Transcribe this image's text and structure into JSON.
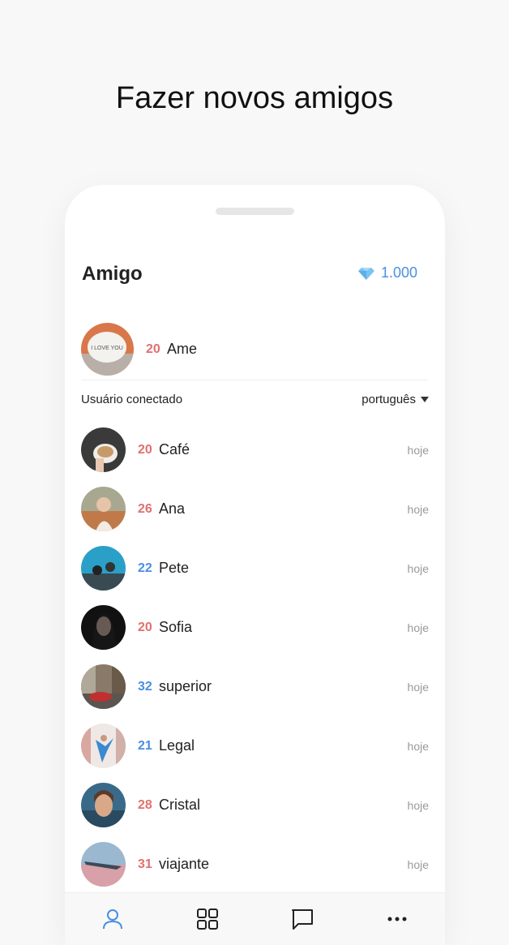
{
  "headline": "Fazer novos amigos",
  "header": {
    "title": "Amigo",
    "gems": "1.000",
    "gem_icon": "diamond-icon"
  },
  "me": {
    "age": "20",
    "name": "Ame",
    "gender": "f"
  },
  "section": {
    "label": "Usuário conectado",
    "language": "português"
  },
  "friends": [
    {
      "age": "20",
      "name": "Café",
      "time": "hoje",
      "gender": "f"
    },
    {
      "age": "26",
      "name": "Ana",
      "time": "hoje",
      "gender": "f"
    },
    {
      "age": "22",
      "name": "Pete",
      "time": "hoje",
      "gender": "m"
    },
    {
      "age": "20",
      "name": "Sofia",
      "time": "hoje",
      "gender": "f"
    },
    {
      "age": "32",
      "name": "superior",
      "time": "hoje",
      "gender": "m"
    },
    {
      "age": "21",
      "name": "Legal",
      "time": "hoje",
      "gender": "m"
    },
    {
      "age": "28",
      "name": "Cristal",
      "time": "hoje",
      "gender": "f"
    },
    {
      "age": "31",
      "name": "viajante",
      "time": "hoje",
      "gender": "f"
    }
  ],
  "tabs": [
    {
      "icon": "person-icon",
      "active": true
    },
    {
      "icon": "grid-icon",
      "active": false
    },
    {
      "icon": "chat-bubble-icon",
      "active": false
    },
    {
      "icon": "more-dots-icon",
      "active": false
    }
  ],
  "colors": {
    "female_age": "#e07070",
    "male_age": "#4a8fe0",
    "accent": "#4a8fe0"
  }
}
